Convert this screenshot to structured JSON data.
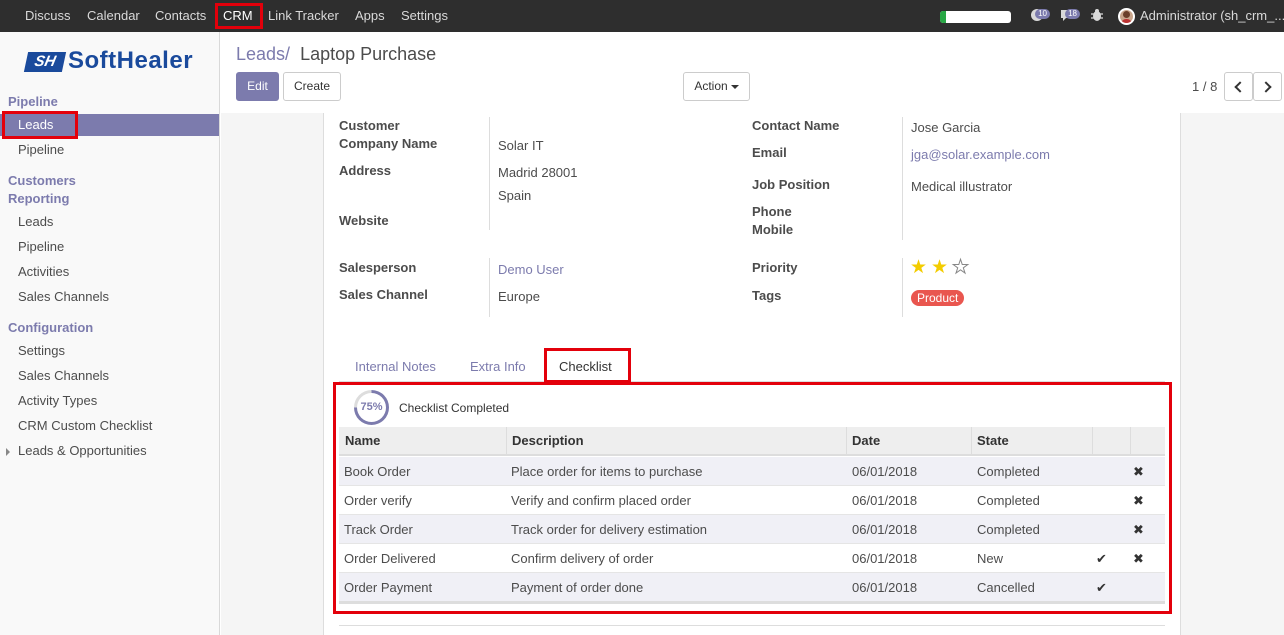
{
  "navbar": {
    "menus": [
      "Discuss",
      "Calendar",
      "Contacts",
      "CRM",
      "Link Tracker",
      "Apps",
      "Settings"
    ],
    "progress": 0.08,
    "activities_count": "10",
    "messages_count": "18",
    "user": "Administrator (sh_crm_..."
  },
  "sidebar": {
    "logo_mark": "SH",
    "logo_text": "SoftHealer",
    "sections": {
      "pipeline": "Pipeline",
      "customers": "Customers",
      "reporting": "Reporting",
      "configuration": "Configuration"
    },
    "pipeline_items": [
      "Leads",
      "Pipeline"
    ],
    "reporting_items": [
      "Leads",
      "Pipeline",
      "Activities",
      "Sales Channels"
    ],
    "configuration_items": [
      "Settings",
      "Sales Channels",
      "Activity Types",
      "CRM Custom Checklist",
      "Leads & Opportunities"
    ]
  },
  "control_panel": {
    "breadcrumb_parent": "Leads",
    "breadcrumb_sep": "/",
    "breadcrumb_current": "Laptop Purchase",
    "edit": "Edit",
    "create": "Create",
    "action": "Action",
    "pager": "1 / 8"
  },
  "form": {
    "labels": {
      "customer": "Customer",
      "company_name": "Company Name",
      "address": "Address",
      "website": "Website",
      "contact_name": "Contact Name",
      "email": "Email",
      "job_position": "Job Position",
      "phone": "Phone",
      "mobile": "Mobile",
      "salesperson": "Salesperson",
      "sales_channel": "Sales Channel",
      "priority": "Priority",
      "tags": "Tags"
    },
    "company_name": "Solar IT",
    "address_line1": "Madrid 28001",
    "address_line2": "Spain",
    "contact_name": "Jose Garcia",
    "email": "jga@solar.example.com",
    "job_position": "Medical illustrator",
    "salesperson": "Demo User",
    "sales_channel": "Europe",
    "priority_stars": 2,
    "priority_max": 3,
    "star_color": "#f3cc00",
    "tag": "Product",
    "tag_color": "#e9564f"
  },
  "tabs": [
    "Internal Notes",
    "Extra Info",
    "Checklist"
  ],
  "checklist": {
    "percent_label": "75%",
    "percent": 75,
    "completed_label": "Checklist Completed",
    "columns": [
      "Name",
      "Description",
      "Date",
      "State"
    ],
    "rows": [
      {
        "name": "Book Order",
        "description": "Place order for items to purchase",
        "date": "06/01/2018",
        "state": "Completed",
        "check": false,
        "remove": true
      },
      {
        "name": "Order verify",
        "description": "Verify and confirm placed order",
        "date": "06/01/2018",
        "state": "Completed",
        "check": false,
        "remove": true
      },
      {
        "name": "Track Order",
        "description": "Track order for delivery estimation",
        "date": "06/01/2018",
        "state": "Completed",
        "check": false,
        "remove": true
      },
      {
        "name": "Order Delivered",
        "description": "Confirm delivery of order",
        "date": "06/01/2018",
        "state": "New",
        "check": true,
        "remove": true
      },
      {
        "name": "Order Payment",
        "description": "Payment of order done",
        "date": "06/01/2018",
        "state": "Cancelled",
        "check": true,
        "remove": false
      }
    ],
    "check_icon": "check-icon",
    "remove_icon": "close-icon"
  }
}
